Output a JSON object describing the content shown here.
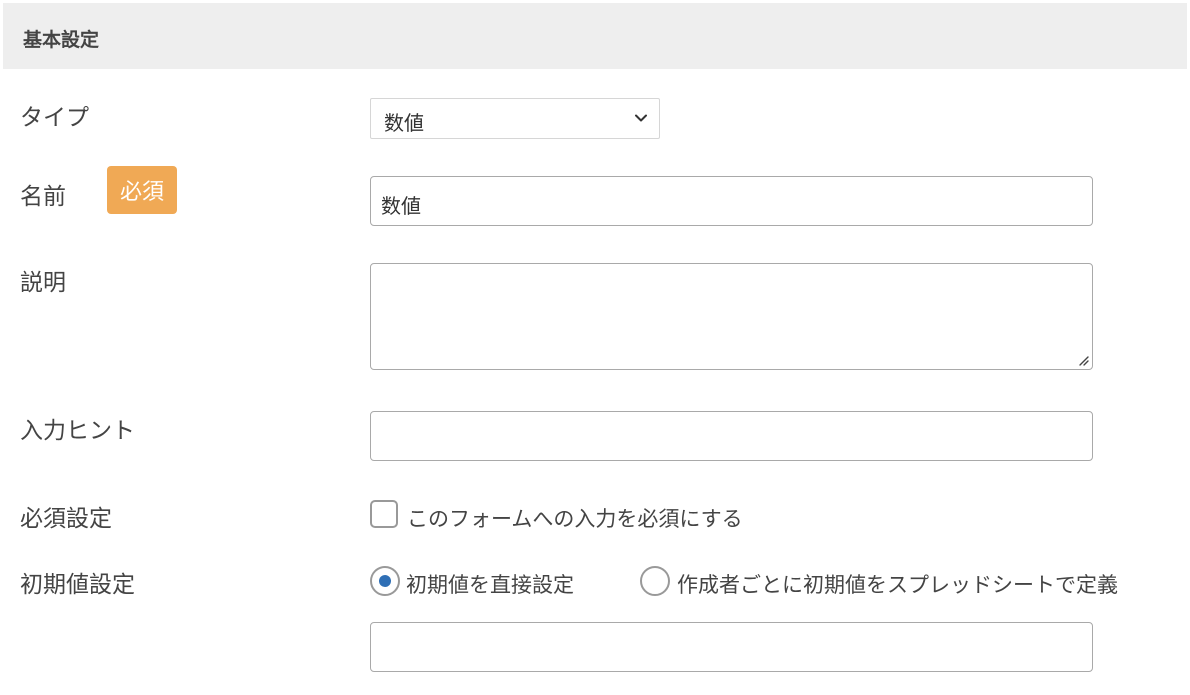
{
  "section": {
    "title": "基本設定"
  },
  "fields": {
    "type": {
      "label": "タイプ",
      "value": "数値"
    },
    "name": {
      "label": "名前",
      "badge": "必須",
      "value": "数値"
    },
    "description": {
      "label": "説明",
      "value": ""
    },
    "hint": {
      "label": "入力ヒント",
      "value": ""
    },
    "required": {
      "label": "必須設定",
      "checkbox_label": "このフォームへの入力を必須にする",
      "checked": false
    },
    "default": {
      "label": "初期値設定",
      "options": [
        {
          "label": "初期値を直接設定",
          "selected": true
        },
        {
          "label": "作成者ごとに初期値をスプレッドシートで定義",
          "selected": false
        }
      ],
      "value": ""
    }
  },
  "colors": {
    "badge": "#f0a955",
    "radio_selected": "#2f6fb5",
    "header_bg": "#eeeeee"
  }
}
